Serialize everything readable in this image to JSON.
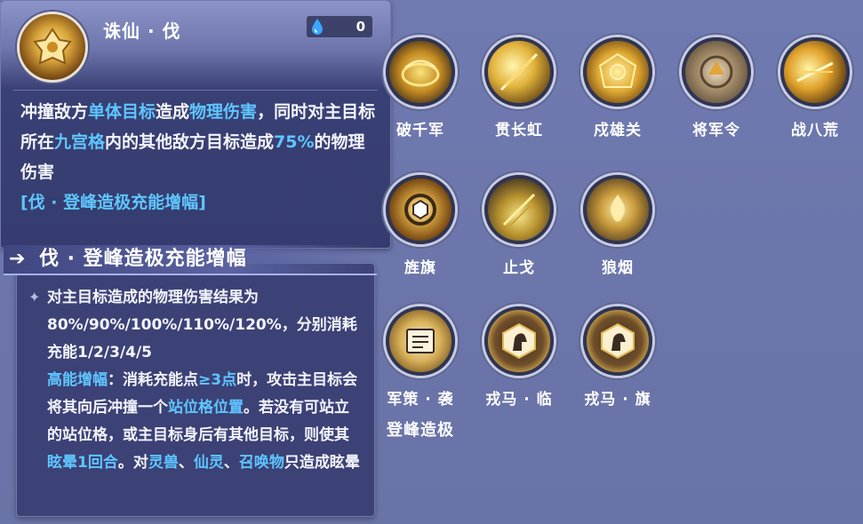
{
  "skill_tooltip": {
    "title": "诛仙 · 伐",
    "cost": "0",
    "desc_parts": [
      {
        "t": "冲撞敌方",
        "hl": false
      },
      {
        "t": "单体目标",
        "hl": true
      },
      {
        "t": "造成",
        "hl": false
      },
      {
        "t": "物理伤害",
        "hl": true
      },
      {
        "t": "，同时对主目标所在",
        "hl": false
      },
      {
        "t": "九宫格",
        "hl": true
      },
      {
        "t": "内的其他敌方目标造成",
        "hl": false
      },
      {
        "t": "75%",
        "hl": true
      },
      {
        "t": "的物理伤害",
        "hl": false
      }
    ],
    "tag": "[伐 · 登峰造极充能增幅]"
  },
  "sub_tooltip": {
    "title": "伐 · 登峰造极充能增幅",
    "desc_parts": [
      {
        "t": "对主目标造成的物理伤害结果为80%/90%/100%/110%/120%，分别消耗充能1/2/3/4/5",
        "hl": false,
        "br": true
      },
      {
        "t": "高能增幅",
        "hl": true
      },
      {
        "t": "：消耗充能点",
        "hl": false
      },
      {
        "t": "≥3点",
        "hl": true
      },
      {
        "t": "时，攻击主目标会将其向后冲撞一个",
        "hl": false
      },
      {
        "t": "站位格位置",
        "hl": true
      },
      {
        "t": "。若没有可站立的站位格，或主目标身后有其他目标，则使其",
        "hl": false
      },
      {
        "t": "眩晕1回合",
        "hl": true
      },
      {
        "t": "。对",
        "hl": false
      },
      {
        "t": "灵兽",
        "hl": true
      },
      {
        "t": "、",
        "hl": false
      },
      {
        "t": "仙灵",
        "hl": true
      },
      {
        "t": "、",
        "hl": false
      },
      {
        "t": "召唤物",
        "hl": true
      },
      {
        "t": "只造成眩晕",
        "hl": false
      }
    ]
  },
  "skills": {
    "破千军": "破千军",
    "贯长虹": "贯长虹",
    "戍雄关": "戍雄关",
    "将军令": "将军令",
    "战八荒": "战八荒",
    "旌旗": "旌旗",
    "止戈": "止戈",
    "狼烟": "狼烟",
    "军策·袭": "军策 · 袭",
    "戎马·临": "戎马 · 临",
    "戎马·旗": "戎马 · 旗",
    "登峰造极": "登峰造极"
  },
  "colors": {
    "highlight": "#5ec6ff",
    "background": "#6f7ab0",
    "tooltip_bg": "#3a4076"
  },
  "icons": {
    "cost": "water-drop-icon",
    "arrow": "arrow-right-icon",
    "bullet": "sparkle-star-icon"
  }
}
